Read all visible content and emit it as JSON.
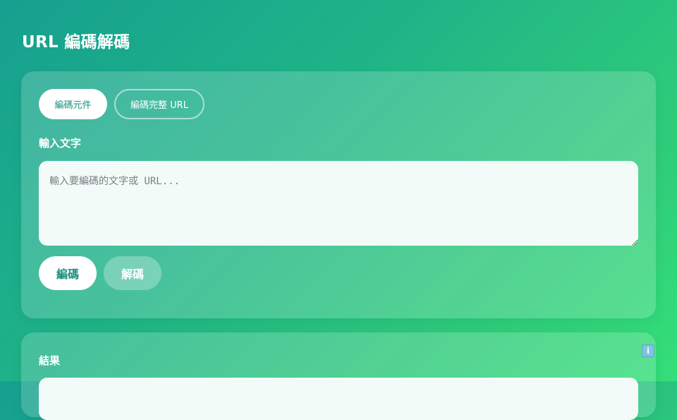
{
  "page": {
    "title": "URL 編碼解碼"
  },
  "input_card": {
    "tabs": [
      {
        "label": "編碼元件",
        "active": true
      },
      {
        "label": "編碼完整 URL",
        "active": false
      }
    ],
    "field_label": "輸入文字",
    "textarea": {
      "value": "",
      "placeholder": "輸入要編碼的文字或 URL..."
    },
    "actions": {
      "encode_label": "編碼",
      "decode_label": "解碼"
    }
  },
  "result_card": {
    "field_label": "結果",
    "value": ""
  },
  "floating": {
    "info_icon": "info-icon",
    "info_glyph": "i"
  },
  "colors": {
    "accent": "#17907f",
    "gradient_start": "#16a08f",
    "gradient_end": "#34df78"
  }
}
